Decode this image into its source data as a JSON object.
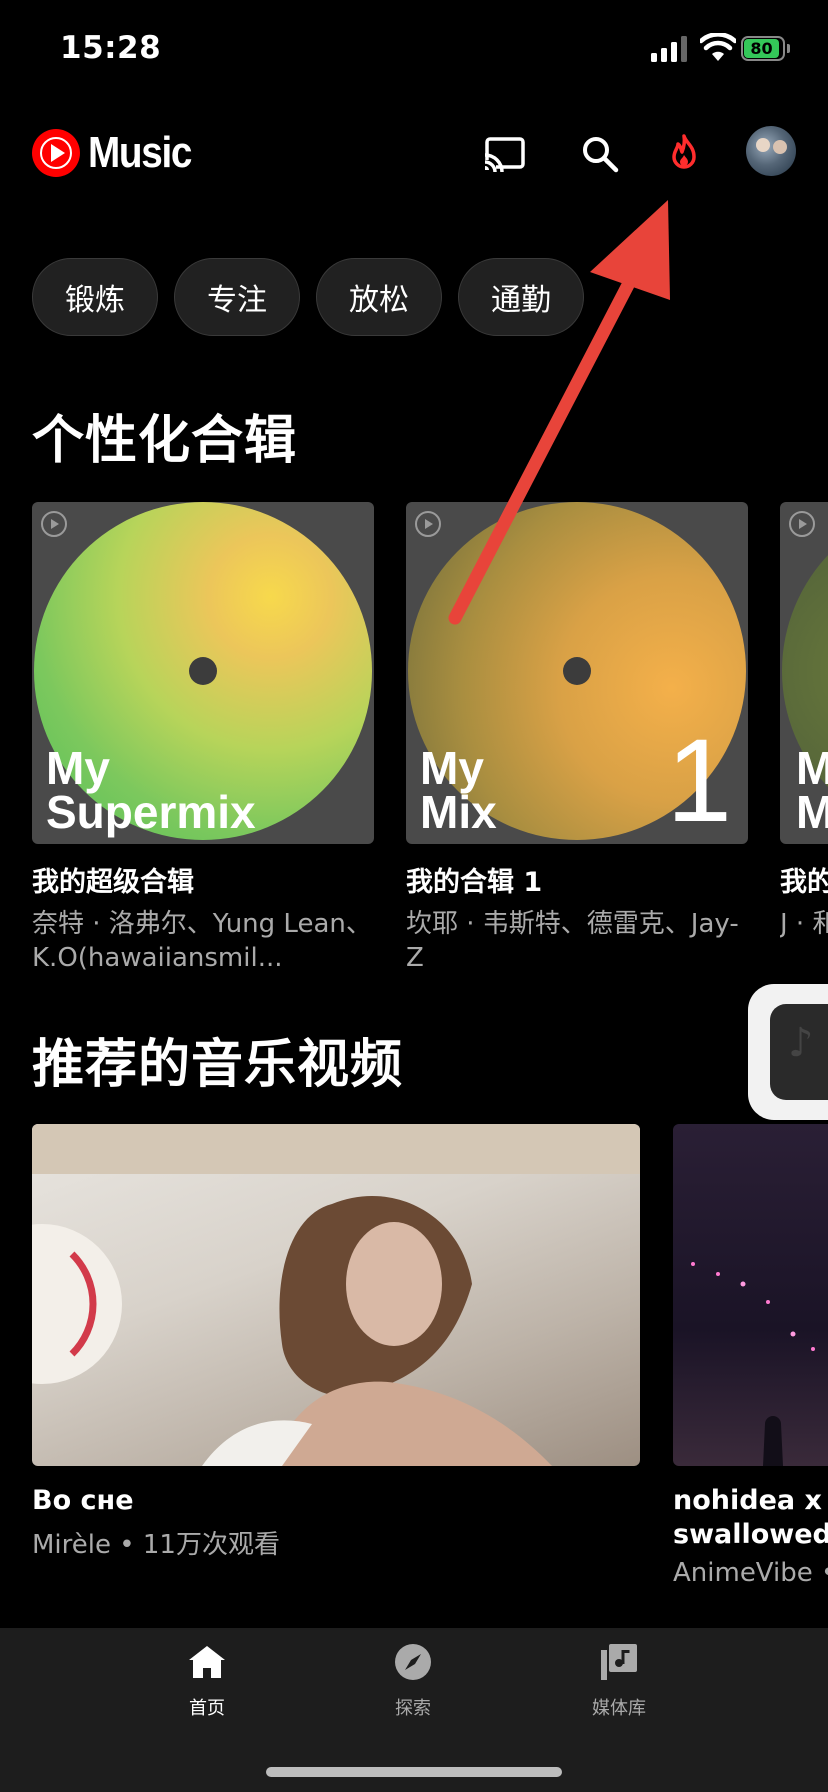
{
  "status_bar": {
    "time": "15:28",
    "battery": "80"
  },
  "app": {
    "logo_text": "Music"
  },
  "header": {
    "icons": [
      "cast-icon",
      "search-icon",
      "fire-icon",
      "avatar"
    ]
  },
  "chips": [
    "锻炼",
    "专注",
    "放松",
    "通勤"
  ],
  "section_mixes": {
    "title": "个性化合辑",
    "items": [
      {
        "art_label_line1": "My",
        "art_label_line2": "Supermix",
        "art_number": "",
        "title": "我的超级合辑",
        "subtitle": "奈特 · 洛弗尔、Yung Lean、K.O(hawaiiansmil..."
      },
      {
        "art_label_line1": "My",
        "art_label_line2": "Mix",
        "art_number": "1",
        "title": "我的合辑 1",
        "subtitle": "坎耶 · 韦斯特、德雷克、Jay-Z"
      },
      {
        "art_label_line1": "M",
        "art_label_line2": "M",
        "art_number": "",
        "title": "我的",
        "subtitle": "J · 和 韦斯"
      }
    ]
  },
  "section_videos": {
    "title": "推荐的音乐视频",
    "items": [
      {
        "title": "Во сне",
        "subtitle": "Mirèle • 11万次观看"
      },
      {
        "title": "nohidea x ki swallowed n",
        "subtitle": "AnimeVibe •"
      }
    ]
  },
  "bottom_nav": [
    {
      "label": "首页",
      "icon": "home-icon",
      "active": true
    },
    {
      "label": "探索",
      "icon": "compass-icon",
      "active": false
    },
    {
      "label": "媒体库",
      "icon": "library-icon",
      "active": false
    }
  ],
  "colors": {
    "brand_red": "#ff0000",
    "annotation_arrow": "#e8443a",
    "background": "#000000"
  }
}
